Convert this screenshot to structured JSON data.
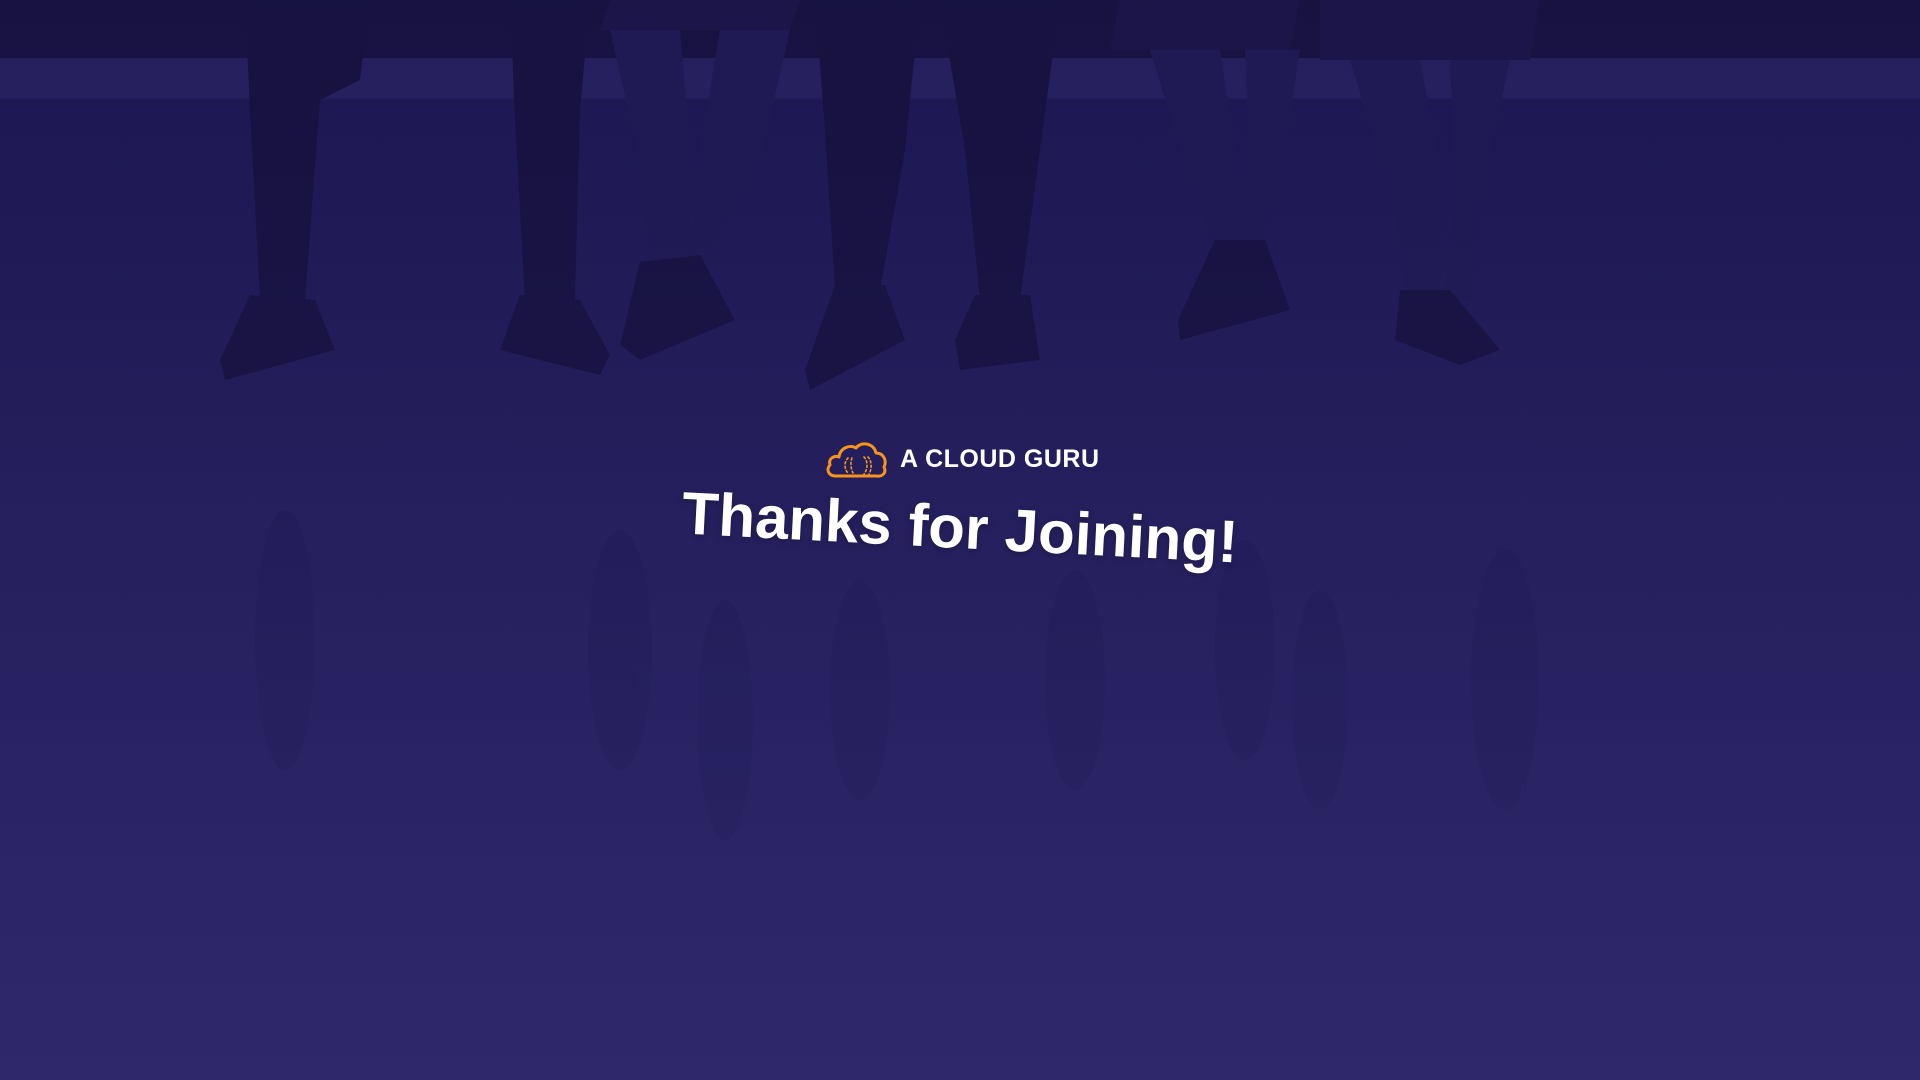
{
  "brand": {
    "name": "A CLOUD GURU",
    "icon": "cloud-logo-icon",
    "icon_color": "#f7941d"
  },
  "headline": {
    "text": "Thanks for Joining!"
  },
  "colors": {
    "overlay": "#2a2462",
    "text": "#ffffff",
    "accent": "#f7941d"
  }
}
